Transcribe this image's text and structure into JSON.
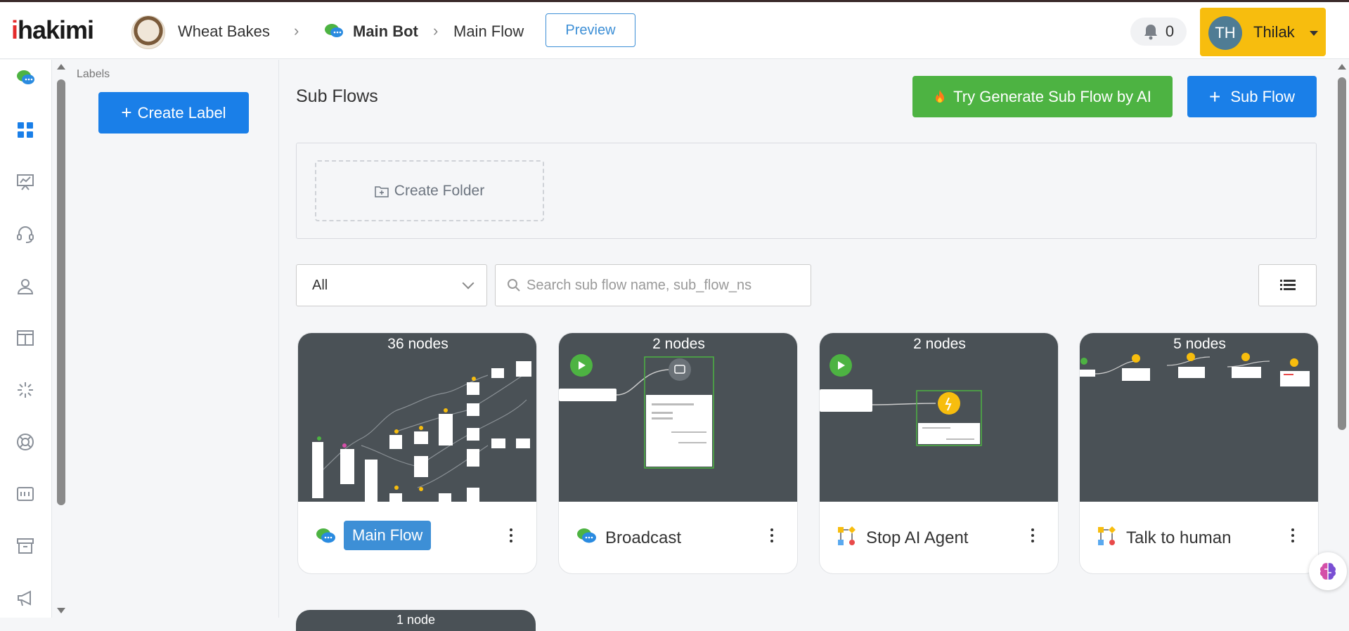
{
  "header": {
    "logo_i": "i",
    "logo_rest": "hakimi",
    "brand": "Wheat Bakes",
    "bot": "Main Bot",
    "flow": "Main Flow",
    "preview_label": "Preview",
    "notifications": "0",
    "user_initials": "TH",
    "user_name": "Thilak"
  },
  "rail": {
    "icons": [
      "chat-icon",
      "dashboard-icon",
      "analytics-icon",
      "headset-icon",
      "user-icon",
      "layout-icon",
      "sparkle-icon",
      "lifebuoy-icon",
      "id-card-icon",
      "archive-icon",
      "megaphone-icon"
    ]
  },
  "labels": {
    "title": "Labels",
    "create_label": "Create Label"
  },
  "main": {
    "title": "Sub Flows",
    "ai_button": "Try Generate Sub Flow by AI",
    "subflow_button": "Sub Flow",
    "create_folder": "Create Folder",
    "filter_value": "All",
    "search_placeholder": "Search sub flow name, sub_flow_ns"
  },
  "cards": [
    {
      "count": "36 nodes",
      "name": "Main Flow",
      "icon": "chat-icon",
      "active": true
    },
    {
      "count": "2 nodes",
      "name": "Broadcast",
      "icon": "chat-icon",
      "active": false
    },
    {
      "count": "2 nodes",
      "name": "Stop AI Agent",
      "icon": "flow-icon",
      "active": false
    },
    {
      "count": "5 nodes",
      "name": "Talk to human",
      "icon": "flow-icon",
      "active": false
    }
  ],
  "next_card": {
    "count": "1 node"
  },
  "colors": {
    "primary": "#1a7fe8",
    "ai_green": "#4db342",
    "user_yellow": "#f7bd0e",
    "logo_red": "#e42b2b",
    "preview_bg": "#4a5156"
  }
}
